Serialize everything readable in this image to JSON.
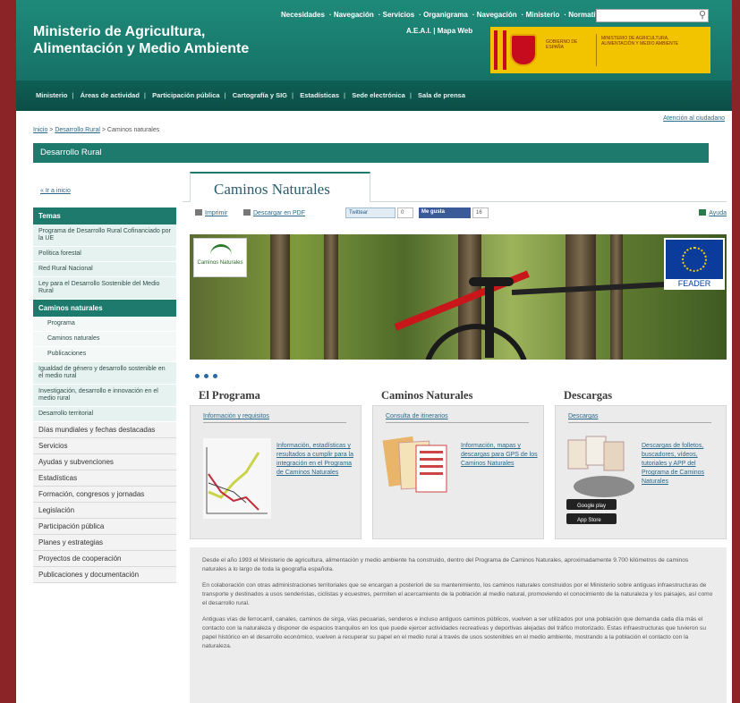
{
  "header": {
    "title_line1": "Ministerio de Agricultura,",
    "title_line2": "Alimentación y Medio Ambiente",
    "util_links": [
      "Necesidades",
      "Navegación",
      "Servicios",
      "Organigrama",
      "Navegación",
      "Ministerio",
      "Normativa"
    ],
    "util_links2": "A.E.A.I. | Mapa Web",
    "gov_text1": "GOBIERNO DE ESPAÑA",
    "gov_text2": "MINISTERIO DE AGRICULTURA, ALIMENTACIÓN Y MEDIO AMBIENTE"
  },
  "nav": {
    "items": [
      "Ministerio",
      "Áreas de actividad",
      "Participación pública",
      "Cartografía y SIG",
      "Estadísticas",
      "Sede electrónica",
      "Sala de prensa"
    ]
  },
  "breadcrumb": {
    "home": "Inicio",
    "section": "Desarrollo Rural",
    "current": "Caminos naturales"
  },
  "attention_link": "Atención al ciudadano",
  "section_bar": "Desarrollo Rural",
  "sidebar": {
    "back": "« Ir a inicio",
    "temas_header": "Temas",
    "temas": [
      "Programa de Desarrollo Rural Cofinanciado por la UE",
      "Política forestal",
      "Red Rural Nacional",
      "Ley para el Desarrollo Sostenible del Medio Rural"
    ],
    "caminos_header": "Caminos naturales",
    "caminos_sub": [
      "Programa",
      "Caminos naturales",
      "Publicaciones"
    ],
    "more_temas": [
      "Igualdad de género y desarrollo sostenible en el medio rural",
      "Investigación, desarrollo e innovación en el medio rural",
      "Desarrollo territorial"
    ],
    "plain": [
      "Días mundiales y fechas destacadas",
      "Servicios",
      "Ayudas y subvenciones",
      "Estadísticas",
      "Formación, congresos y jornadas",
      "Legislación",
      "Participación pública",
      "Planes y estrategias",
      "Proyectos de cooperación",
      "Publicaciones y documentación"
    ]
  },
  "main": {
    "tab_title": "Caminos Naturales",
    "tools": {
      "print": "Imprimir",
      "pdf": "Descargar en PDF",
      "tweet": "Twittear",
      "tweet_count": "0",
      "like": "Me gusta",
      "like_count": "16",
      "help": "Ayuda"
    },
    "banner": {
      "logo_text": "Caminos Naturales",
      "eu_label": "FEADER"
    },
    "columns": [
      {
        "title": "El Programa",
        "link": "Información y requisitos",
        "desc": "Información, estadísticas y resultados a cumplir para la integración en el Programa de Caminos Naturales"
      },
      {
        "title": "Caminos Naturales",
        "link": "Consulta de itinerarios",
        "desc": "Información, mapas y descargas para GPS de los Caminos Naturales"
      },
      {
        "title": "Descargas",
        "link": "Descargas",
        "desc": "Descargas de folletos, buscadores, vídeos, tutoriales y APP del Programa de Caminos Naturales"
      }
    ],
    "paragraphs": [
      "Desde el año 1993 el Ministerio de agricultura, alimentación y medio ambiente ha construido, dentro del Programa de Caminos Naturales, aproximadamente 9.700 kilómetros de caminos naturales a lo largo de toda la geografía española.",
      "En colaboración con otras administraciones territoriales que se encargan a posteriori de su mantenimiento, los caminos naturales construidos por el Ministerio sobre antiguas infraestructuras de transporte y destinados a usos senderistas, ciclistas y ecuestres, permiten el acercamiento de la población al medio natural, promoviendo el conocimiento de la naturaleza y los paisajes, así como el desarrollo rural.",
      "Antiguas vías de ferrocarril, canales, caminos de sirga, vías pecuarias, senderos e incluso antiguos caminos públicos, vuelven a ser utilizados por una población que demanda cada día más el contacto con la naturaleza y disponer de espacios tranquilos en los que puede ejercer actividades recreativas y deportivas alejadas del tráfico motorizado. Estas infraestructuras que tuvieron su papel histórico en el desarrollo económico, vuelven a recuperar su papel en el medio rural a través de usos sostenibles en el medio ambiente, mostrando a la población el contacto con la naturaleza."
    ]
  },
  "colors": {
    "page_border": "#8b2426",
    "header": "#1f8a79",
    "nav": "#0f5f55",
    "accent": "#1f7a6e"
  }
}
